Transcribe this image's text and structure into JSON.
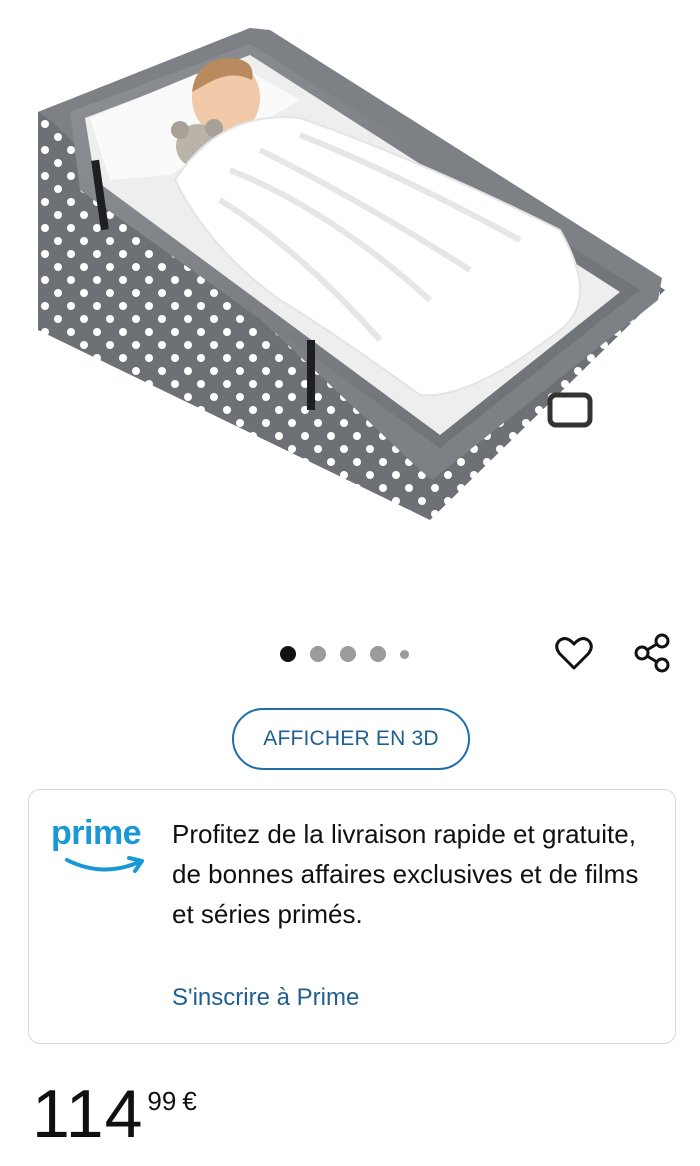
{
  "product": {
    "image_alt": "Lit de voyage pliable gris à pois blancs avec enfant endormi",
    "carousel": {
      "count": 5,
      "active_index": 0
    }
  },
  "actions": {
    "view_3d_label": "AFFICHER EN 3D"
  },
  "prime": {
    "logo_text": "prime",
    "message": "Profitez de la livraison rapide et gratuite, de bonnes affaires exclusives et de films et séries primés.",
    "link_label": "S'inscrire à Prime"
  },
  "price": {
    "whole": "114",
    "fraction": "99",
    "currency": "€"
  },
  "colors": {
    "link_blue": "#1f5f90",
    "prime_blue": "#1a98d5",
    "bed_grey": "#6b6e72"
  },
  "icons": [
    "heart-icon",
    "share-icon",
    "prime-smile-icon"
  ]
}
